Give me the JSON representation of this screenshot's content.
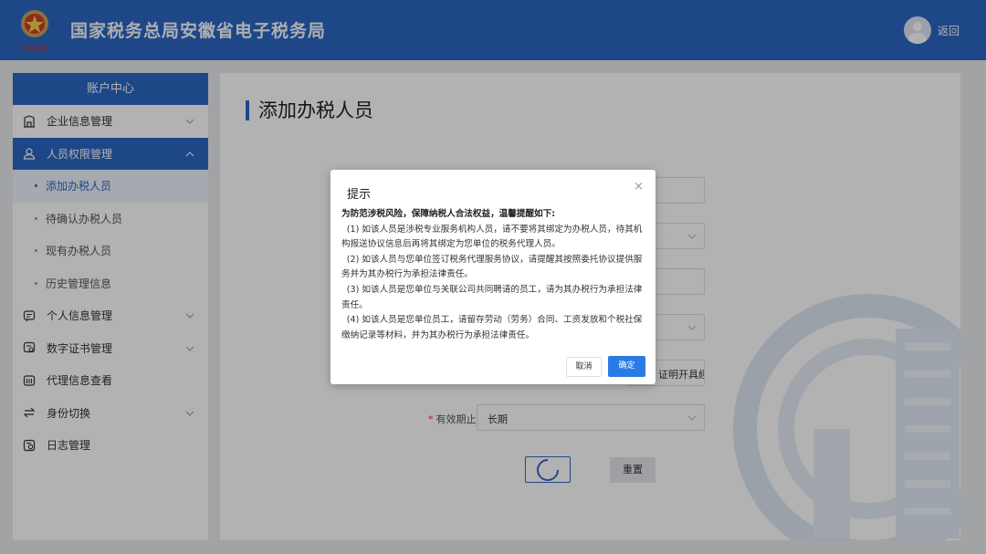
{
  "header": {
    "title": "国家税务总局安徽省电子税务局",
    "return_label": "返回",
    "logo_text": "中国税务"
  },
  "sidebar": {
    "heading": "账户中心",
    "items": [
      {
        "label": "企业信息管理",
        "icon": "building-icon"
      },
      {
        "label": "人员权限管理",
        "icon": "user-shield-icon"
      },
      {
        "label": "个人信息管理",
        "icon": "profile-card-icon"
      },
      {
        "label": "数字证书管理",
        "icon": "certificate-icon"
      },
      {
        "label": "代理信息查看",
        "icon": "agent-info-icon"
      },
      {
        "label": "身份切换",
        "icon": "switch-identity-icon"
      },
      {
        "label": "日志管理",
        "icon": "log-icon"
      }
    ],
    "sub_items": [
      "添加办税人员",
      "待确认办税人员",
      "现有办税人员",
      "历史管理信息"
    ]
  },
  "main": {
    "title": "添加办税人员",
    "partial_field_value": "证明开具經",
    "validity_label": "有效期止",
    "validity_value": "长期",
    "reset_label": "重置"
  },
  "dialog": {
    "title": "提示",
    "close": "×",
    "lead": "为防范涉税风险，保障纳税人合法权益，温馨提醒如下:",
    "paragraphs": [
      "(1) 如该人员是涉税专业服务机构人员，请不要将其绑定为办税人员，待其机构报送协议信息后再将其绑定为您单位的税务代理人员。",
      "(2) 如该人员与您单位签订税务代理服务协议，请提醒其按照委托协议提供服务并为其办税行为承担法律责任。",
      "(3) 如该人员是您单位与关联公司共同聘请的员工，请为其办税行为承担法律责任。",
      "(4) 如该人员是您单位员工，请留存劳动（劳务）合同、工资发放和个税社保缴纳记录等材料，并为其办税行为承担法律责任。"
    ],
    "cancel_label": "取消",
    "ok_label": "确定"
  },
  "colors": {
    "brand_blue": "#2b66c3",
    "primary_button": "#2b7be4",
    "required_star": "#e53935"
  }
}
